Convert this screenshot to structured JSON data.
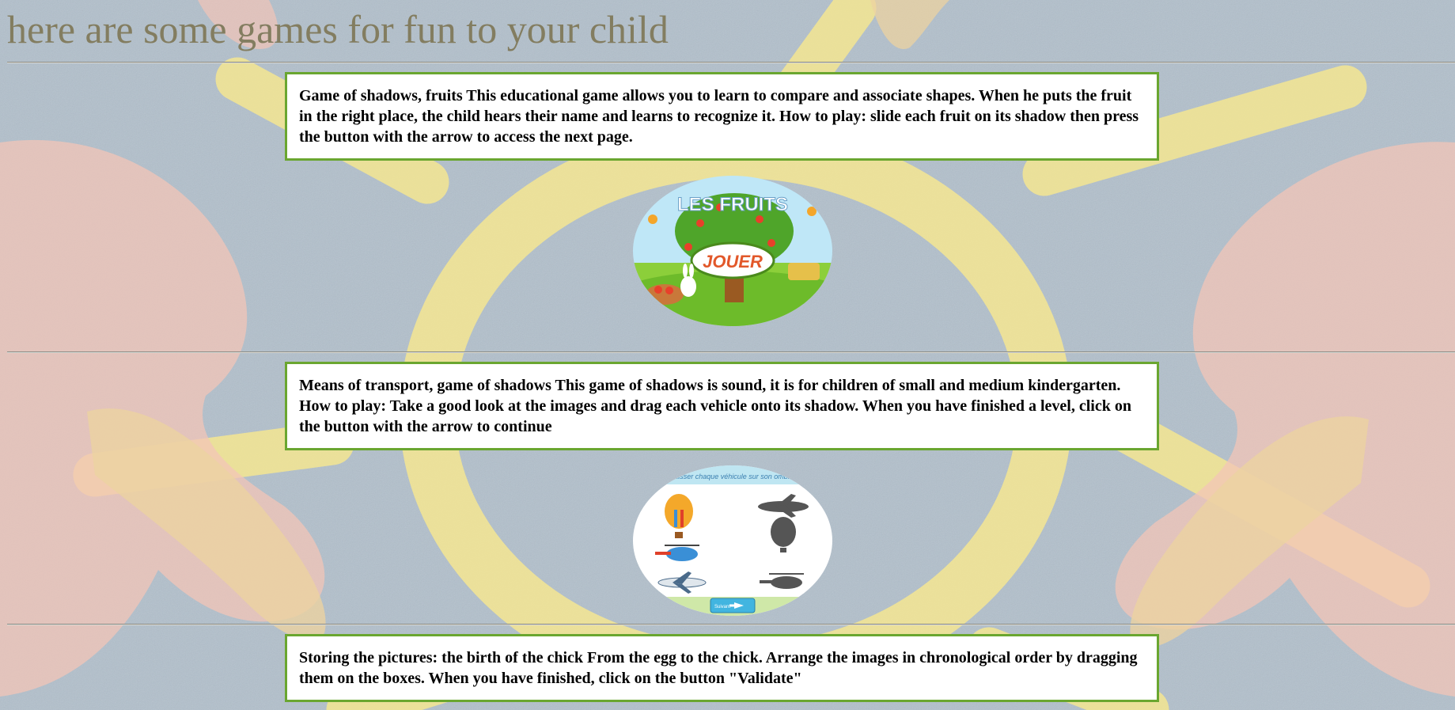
{
  "page": {
    "title": "here are some games for fun to your child"
  },
  "games": [
    {
      "description": "Game of shadows, fruits This educational game allows you to learn to compare and associate shapes. When he puts the fruit in the right place, the child hears their name and learns to recognize it. How to play: slide each fruit on its shadow then press the button with the arrow to access the next page.",
      "thumbnail": {
        "heading": "LES FRUITS",
        "play_label": "JOUER"
      }
    },
    {
      "description": "Means of transport, game of shadows This game of shadows is sound, it is for children of small and medium kindergarten. How to play: Take a good look at the images and drag each vehicle onto its shadow. When you have finished a level, click on the button with the arrow to continue",
      "thumbnail": {
        "instruction": "Glisser chaque véhicule sur son ombre",
        "next_label": "Suivant"
      }
    },
    {
      "description": "Storing the pictures: the birth of the chick From the egg to the chick. Arrange the images in chronological order by dragging them on the boxes. When you have finished, click on the button \"Validate\""
    }
  ],
  "colors": {
    "title": "#837d60",
    "box_border": "#6aa630",
    "chalk_yellow": "#f3e27a"
  }
}
